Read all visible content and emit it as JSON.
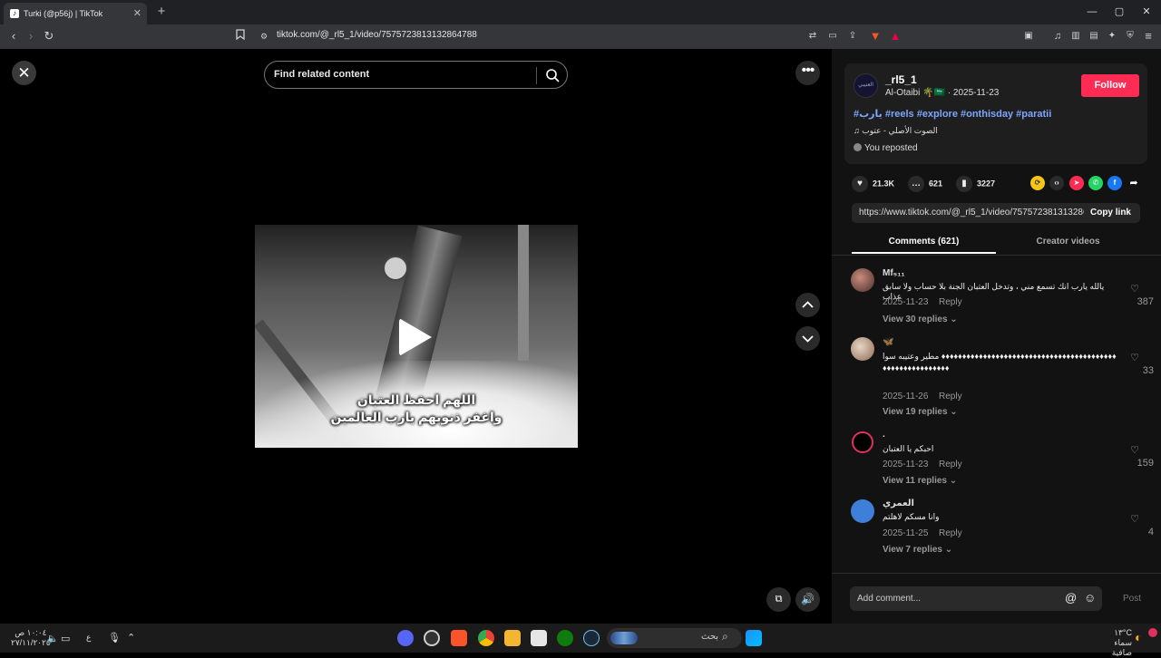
{
  "browser": {
    "tab_title": "Turki (@p56j) | TikTok",
    "tab_close": "✕",
    "new_tab": "+",
    "url": "tiktok.com/@_rl5_1/video/7575723813132864788",
    "window_controls": {
      "minimize": "—",
      "maximize": "▢",
      "close": "✕"
    }
  },
  "video": {
    "search_placeholder": "Find related content",
    "caption_line1": "اللهم احفظ العتبان",
    "caption_line2": "واغفر ذنوبهم يارب العالمين"
  },
  "post": {
    "avatar_text": "العتيبي",
    "author": "_rl5_1",
    "subline": "Al-Otaibi 🌴🇸🇦 · 2025-11-23",
    "follow_label": "Follow",
    "hashtags": "#يارب #reels #explore #onthisday #paratii",
    "sound": "♫ الصوت الأصلي - عتوب",
    "repost_label": "You reposted",
    "likes": "21.3K",
    "comments_count": "621",
    "saves": "3227",
    "share_link": "https://www.tiktok.com/@_rl5_1/video/757572381313286...",
    "copy_link_label": "Copy link"
  },
  "tabs": {
    "comments": "Comments (621)",
    "creator_videos": "Creator videos"
  },
  "comments": [
    {
      "name": "Mf₅₁₁",
      "text": "يالله يارب انك تسمع مني ، وتدخل العتبان الجنة بلا حساب ولا سابق عذاب",
      "date": "2025-11-23",
      "reply": "Reply",
      "likes": "387",
      "view_replies": "View 30 replies ⌄"
    },
    {
      "name": "🦋",
      "text": "مطير وعتيبه سوا ♦♦♦♦♦♦♦♦♦♦♦♦♦♦♦♦♦♦♦♦♦♦♦♦♦♦♦♦♦♦♦♦♦♦♦♦♦♦♦♦♦♦♦♦♦♦♦♦♦♦♦♦♦♦♦♦♦♦",
      "date": "2025-11-26",
      "reply": "Reply",
      "likes": "33",
      "view_replies": "View 19 replies ⌄"
    },
    {
      "name": ".",
      "text": "احبكم يا العتبان",
      "date": "2025-11-23",
      "reply": "Reply",
      "likes": "159",
      "view_replies": "View 11 replies ⌄"
    },
    {
      "name": "العمري",
      "text": "وانا مسكم لاهلتم",
      "date": "2025-11-25",
      "reply": "Reply",
      "likes": "4",
      "view_replies": "View 7 replies ⌄"
    }
  ],
  "comment_bar": {
    "placeholder": "Add comment...",
    "post_label": "Post"
  },
  "taskbar": {
    "search_text": "بحث",
    "weather_temp": "١٣°C",
    "weather_desc": "سماء صافية",
    "time": "١٠:٠٤ ص",
    "date": "٢٧/١١/٢٠٢٥",
    "lang": "ع"
  },
  "colors": {
    "follow": "#fe2c55",
    "hashtag": "#7da6ff",
    "panel_bg": "#121212"
  }
}
